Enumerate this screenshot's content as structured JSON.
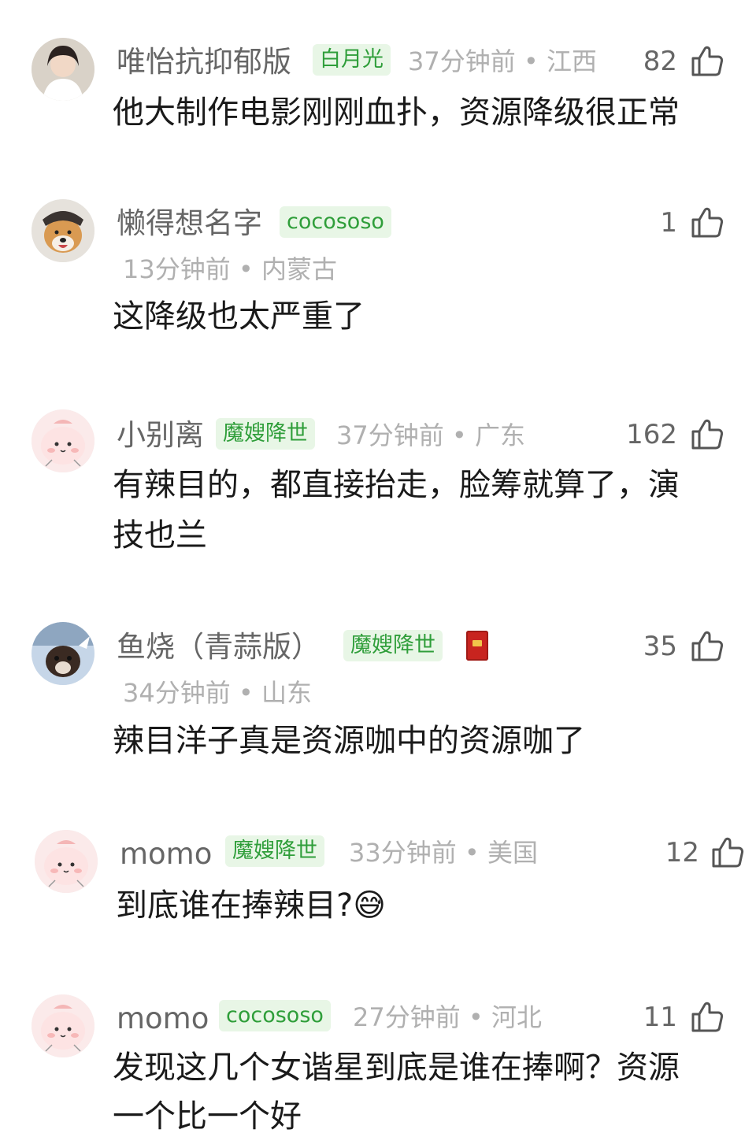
{
  "comments": [
    {
      "username": "唯怡抗抑郁版",
      "badge": "白月光",
      "time": "37分钟前",
      "location": "江西",
      "likes": "82",
      "text": "他大制作电影刚刚血扑，资源降级很正常"
    },
    {
      "username": "懒得想名字",
      "badge": "cocososo",
      "time": "13分钟前",
      "location": "内蒙古",
      "likes": "1",
      "text": "这降级也太严重了"
    },
    {
      "username": "小别离",
      "badge": "魔嫂降世",
      "time": "37分钟前",
      "location": "广东",
      "likes": "162",
      "text_line1": "有辣目的，都直接抬走，脸筹就算了，演",
      "text_line2": "技也兰"
    },
    {
      "username": "鱼烧（青蒜版）",
      "badge": "魔嫂降世",
      "time": "34分钟前",
      "location": "山东",
      "likes": "35",
      "text": "辣目洋子真是资源咖中的资源咖了"
    },
    {
      "username": "momo",
      "badge": "魔嫂降世",
      "time": "33分钟前",
      "location": "美国",
      "likes": "12",
      "text": "到底谁在捧辣目?",
      "emoji": "😅"
    },
    {
      "username": "momo",
      "badge": "cocososo",
      "time": "27分钟前",
      "location": "河北",
      "likes": "11",
      "text_line1": "发现这几个女谐星到底是谁在捧啊？资源",
      "text_line2": "一个比一个好"
    }
  ],
  "separator": "•",
  "colors": {
    "badge_bg": "#e8f6e6",
    "badge_text": "#2f9e3a",
    "meta": "#b0b0b0",
    "name": "#666666",
    "text": "#1a1a1a"
  }
}
